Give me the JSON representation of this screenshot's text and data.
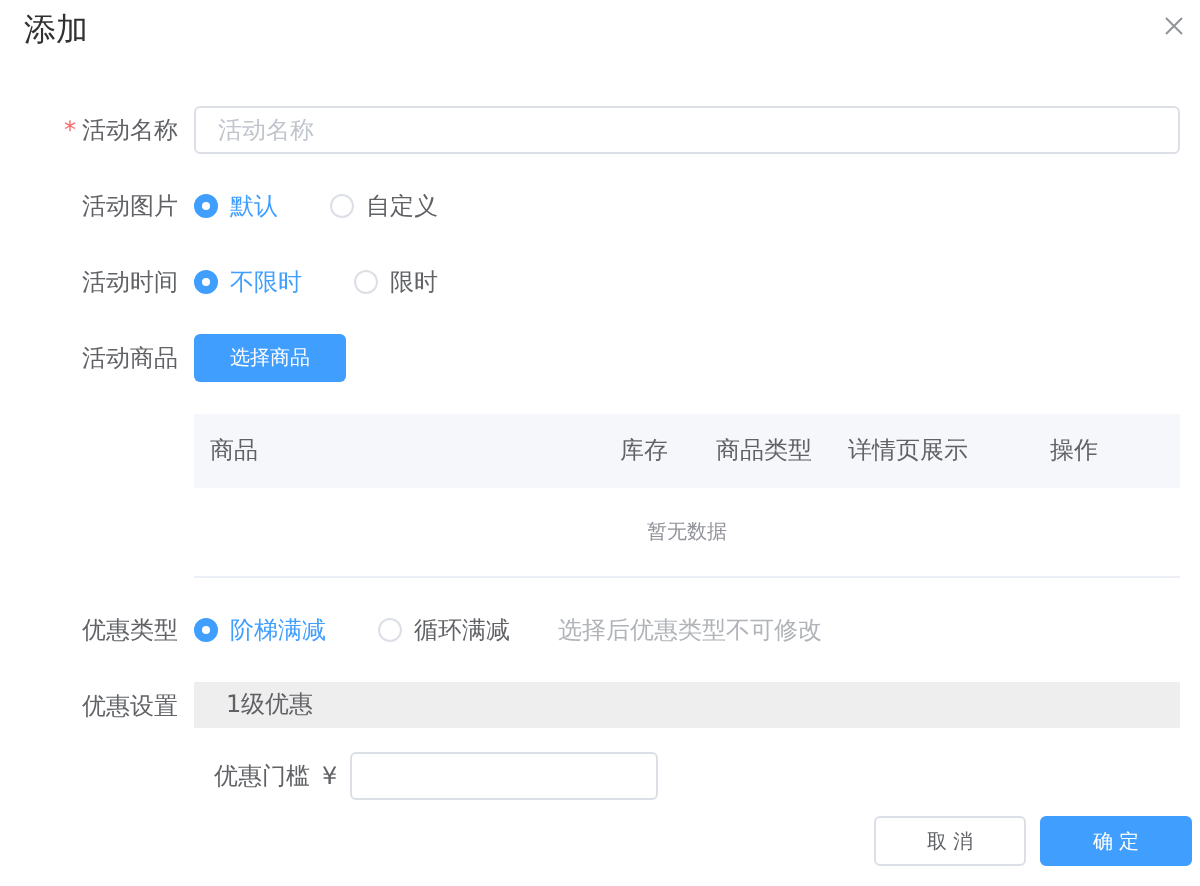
{
  "dialog": {
    "title": "添加"
  },
  "fields": [
    {
      "kind": "input",
      "label": "活动名称",
      "required_mark": "*",
      "placeholder": "活动名称"
    },
    {
      "kind": "radio",
      "label": "活动图片",
      "options": [
        {
          "label": "默认",
          "selected": true
        },
        {
          "label": "自定义",
          "selected": false
        }
      ]
    },
    {
      "kind": "radio",
      "label": "活动时间",
      "options": [
        {
          "label": "不限时",
          "selected": true
        },
        {
          "label": "限时",
          "selected": false
        }
      ]
    },
    {
      "kind": "goods",
      "label": "活动商品",
      "button": "选择商品",
      "table": {
        "columns": [
          "商品",
          "库存",
          "商品类型",
          "详情页展示",
          "操作"
        ],
        "empty_text": "暂无数据"
      }
    },
    {
      "kind": "radio",
      "label": "优惠类型",
      "options": [
        {
          "label": "阶梯满减",
          "selected": true
        },
        {
          "label": "循环满减",
          "selected": false
        }
      ],
      "hint": "选择后优惠类型不可修改"
    },
    {
      "kind": "discount",
      "label": "优惠设置",
      "level_title": "1级优惠",
      "threshold_label": "优惠门槛",
      "currency": "¥"
    }
  ],
  "footer": {
    "buttons": [
      {
        "label": "取 消",
        "kind": "default"
      },
      {
        "label": "确 定",
        "kind": "primary"
      }
    ]
  }
}
